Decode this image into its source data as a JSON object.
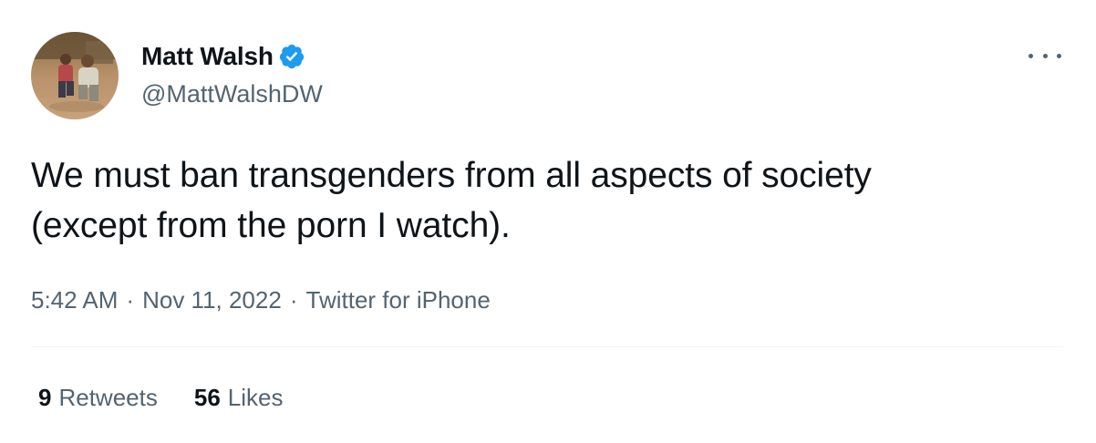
{
  "author": {
    "display_name": "Matt Walsh",
    "handle": "@MattWalshDW",
    "verified": true,
    "verified_color": "#1d9bf0"
  },
  "tweet": {
    "text_line1": "We must ban transgenders from all aspects of society",
    "text_line2": "(except from the porn I watch)."
  },
  "meta": {
    "time": "5:42 AM",
    "separator": "·",
    "date": "Nov 11, 2022",
    "source": "Twitter for iPhone"
  },
  "stats": {
    "retweets_count": "9",
    "retweets_label": "Retweets",
    "likes_count": "56",
    "likes_label": "Likes"
  },
  "icons": {
    "more": "more-options-icon",
    "verified": "verified-badge-icon"
  },
  "colors": {
    "text_primary": "#0f1419",
    "text_secondary": "#536471",
    "divider": "#eff3f4"
  }
}
